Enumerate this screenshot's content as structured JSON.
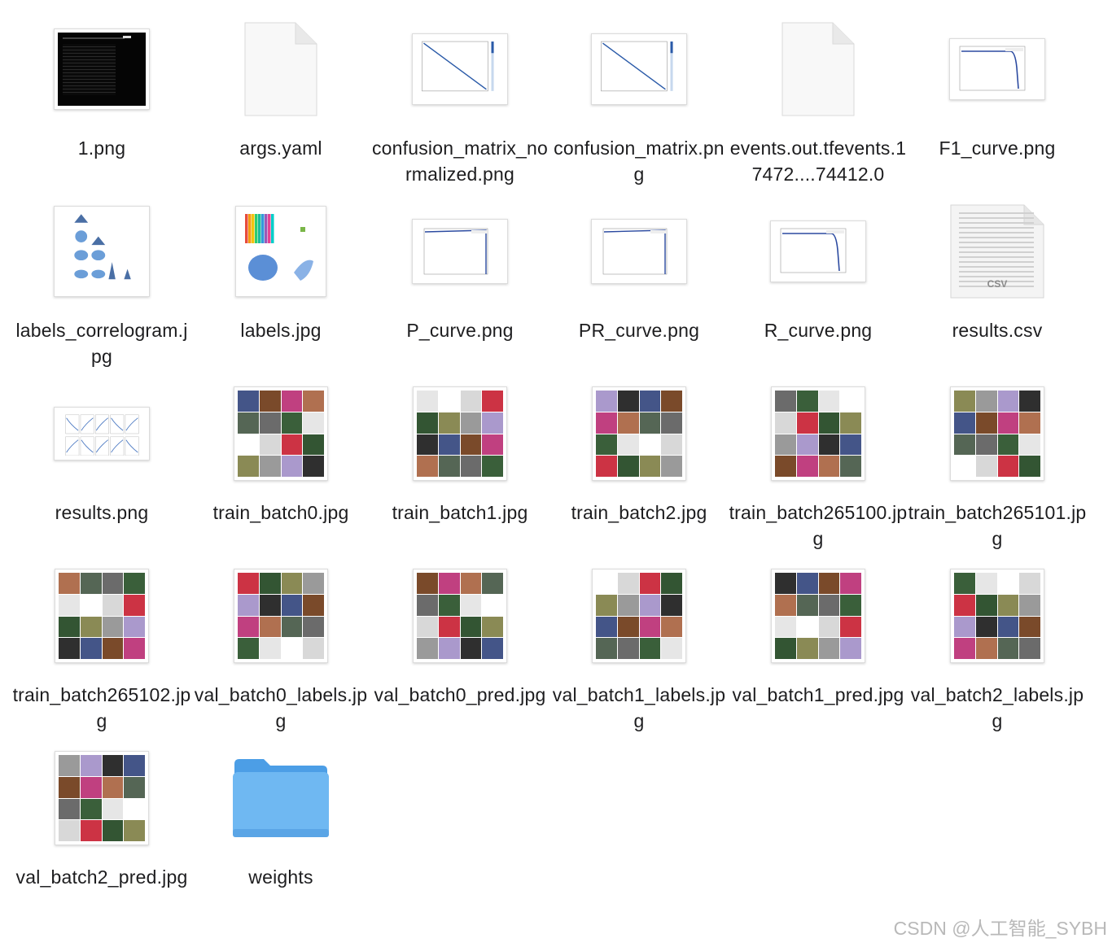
{
  "files": [
    {
      "name": "1.png",
      "kind": "dark"
    },
    {
      "name": "args.yaml",
      "kind": "doc"
    },
    {
      "name": "confusion_matrix_normalized.png",
      "kind": "diag"
    },
    {
      "name": "confusion_matrix.png",
      "kind": "diag"
    },
    {
      "name": "events.out.tfevents.17472....74412.0",
      "kind": "doc"
    },
    {
      "name": "F1_curve.png",
      "kind": "fall"
    },
    {
      "name": "labels_correlogram.jpg",
      "kind": "corr"
    },
    {
      "name": "labels.jpg",
      "kind": "labels"
    },
    {
      "name": "P_curve.png",
      "kind": "flat"
    },
    {
      "name": "PR_curve.png",
      "kind": "flat"
    },
    {
      "name": "R_curve.png",
      "kind": "fall"
    },
    {
      "name": "results.csv",
      "kind": "csv"
    },
    {
      "name": "results.png",
      "kind": "results"
    },
    {
      "name": "train_batch0.jpg",
      "kind": "mosaic"
    },
    {
      "name": "train_batch1.jpg",
      "kind": "mosaic"
    },
    {
      "name": "train_batch2.jpg",
      "kind": "mosaic"
    },
    {
      "name": "train_batch265100.jpg",
      "kind": "mosaic"
    },
    {
      "name": "train_batch265101.jpg",
      "kind": "mosaic"
    },
    {
      "name": "train_batch265102.jpg",
      "kind": "mosaic"
    },
    {
      "name": "val_batch0_labels.jpg",
      "kind": "mosaic"
    },
    {
      "name": "val_batch0_pred.jpg",
      "kind": "mosaic"
    },
    {
      "name": "val_batch1_labels.jpg",
      "kind": "mosaic"
    },
    {
      "name": "val_batch1_pred.jpg",
      "kind": "mosaic"
    },
    {
      "name": "val_batch2_labels.jpg",
      "kind": "mosaic"
    },
    {
      "name": "val_batch2_pred.jpg",
      "kind": "mosaic"
    },
    {
      "name": "weights",
      "kind": "folder"
    }
  ],
  "csv_badge": "CSV",
  "watermark": "CSDN @人工智能_SYBH",
  "colors": {
    "folder": "#6fb8f2",
    "folder_tab": "#4c9ee6",
    "mosaic": [
      "#6b6b6b",
      "#c04080",
      "#2f2f2f",
      "#8a8a55",
      "#d8d8d8",
      "#3a5f3a",
      "#b07050",
      "#445588",
      "#9a9a9a",
      "#cc3344",
      "#e6e6e6",
      "#556655",
      "#7a4a2a",
      "#aa99cc",
      "#335533",
      "#ffffff"
    ]
  }
}
